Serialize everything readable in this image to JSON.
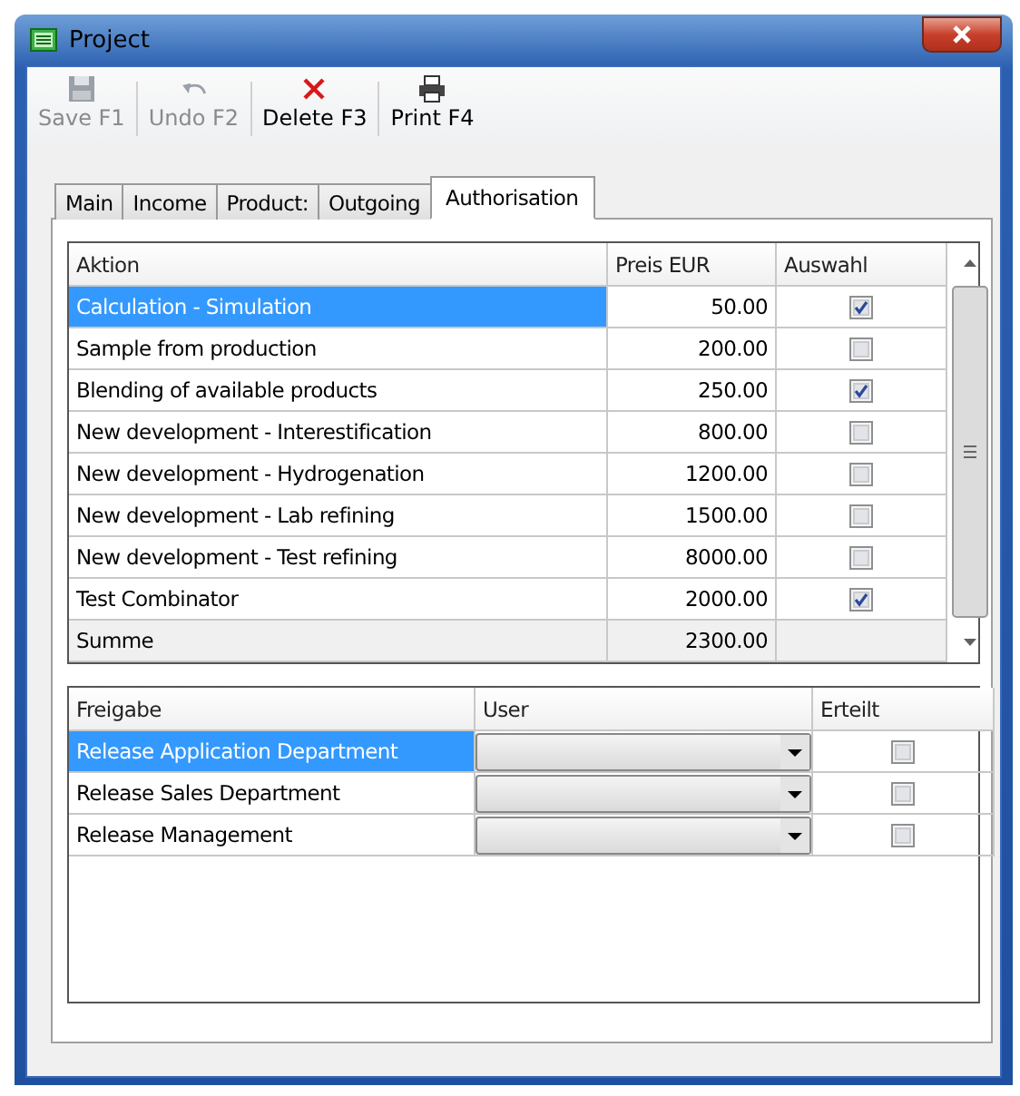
{
  "window": {
    "title": "Project"
  },
  "toolbar": [
    {
      "label": "Save F1",
      "kind": "save",
      "disabled": true
    },
    {
      "label": "Undo F2",
      "kind": "undo",
      "disabled": true
    },
    {
      "label": "Delete F3",
      "kind": "delete",
      "disabled": false
    },
    {
      "label": "Print F4",
      "kind": "print",
      "disabled": false
    }
  ],
  "tabs": [
    {
      "label": "Main",
      "selected": false
    },
    {
      "label": "Income",
      "selected": false
    },
    {
      "label": "Product:",
      "selected": false
    },
    {
      "label": "Outgoing",
      "selected": false
    },
    {
      "label": "Authorisation",
      "selected": true
    }
  ],
  "actions_table": {
    "columns": [
      "Aktion",
      "Preis EUR",
      "Auswahl"
    ],
    "rows": [
      {
        "aktion": "Calculation - Simulation",
        "preis": "50.00",
        "checked": true,
        "selected": true
      },
      {
        "aktion": "Sample from production",
        "preis": "200.00",
        "checked": false,
        "selected": false
      },
      {
        "aktion": "Blending of available products",
        "preis": "250.00",
        "checked": true,
        "selected": false
      },
      {
        "aktion": "New development - Interestification",
        "preis": "800.00",
        "checked": false,
        "selected": false
      },
      {
        "aktion": "New development - Hydrogenation",
        "preis": "1200.00",
        "checked": false,
        "selected": false
      },
      {
        "aktion": "New development - Lab refining",
        "preis": "1500.00",
        "checked": false,
        "selected": false
      },
      {
        "aktion": "New development - Test refining",
        "preis": "8000.00",
        "checked": false,
        "selected": false
      },
      {
        "aktion": "Test Combinator",
        "preis": "2000.00",
        "checked": true,
        "selected": false
      }
    ],
    "total": {
      "label": "Summe",
      "preis": "2300.00"
    }
  },
  "release_table": {
    "columns": [
      "Freigabe",
      "User",
      "Erteilt"
    ],
    "rows": [
      {
        "freigabe": "Release Application Department",
        "erteilt": false,
        "selected": true
      },
      {
        "freigabe": "Release Sales Department",
        "erteilt": false,
        "selected": false
      },
      {
        "freigabe": "Release Management",
        "erteilt": false,
        "selected": false
      }
    ]
  }
}
